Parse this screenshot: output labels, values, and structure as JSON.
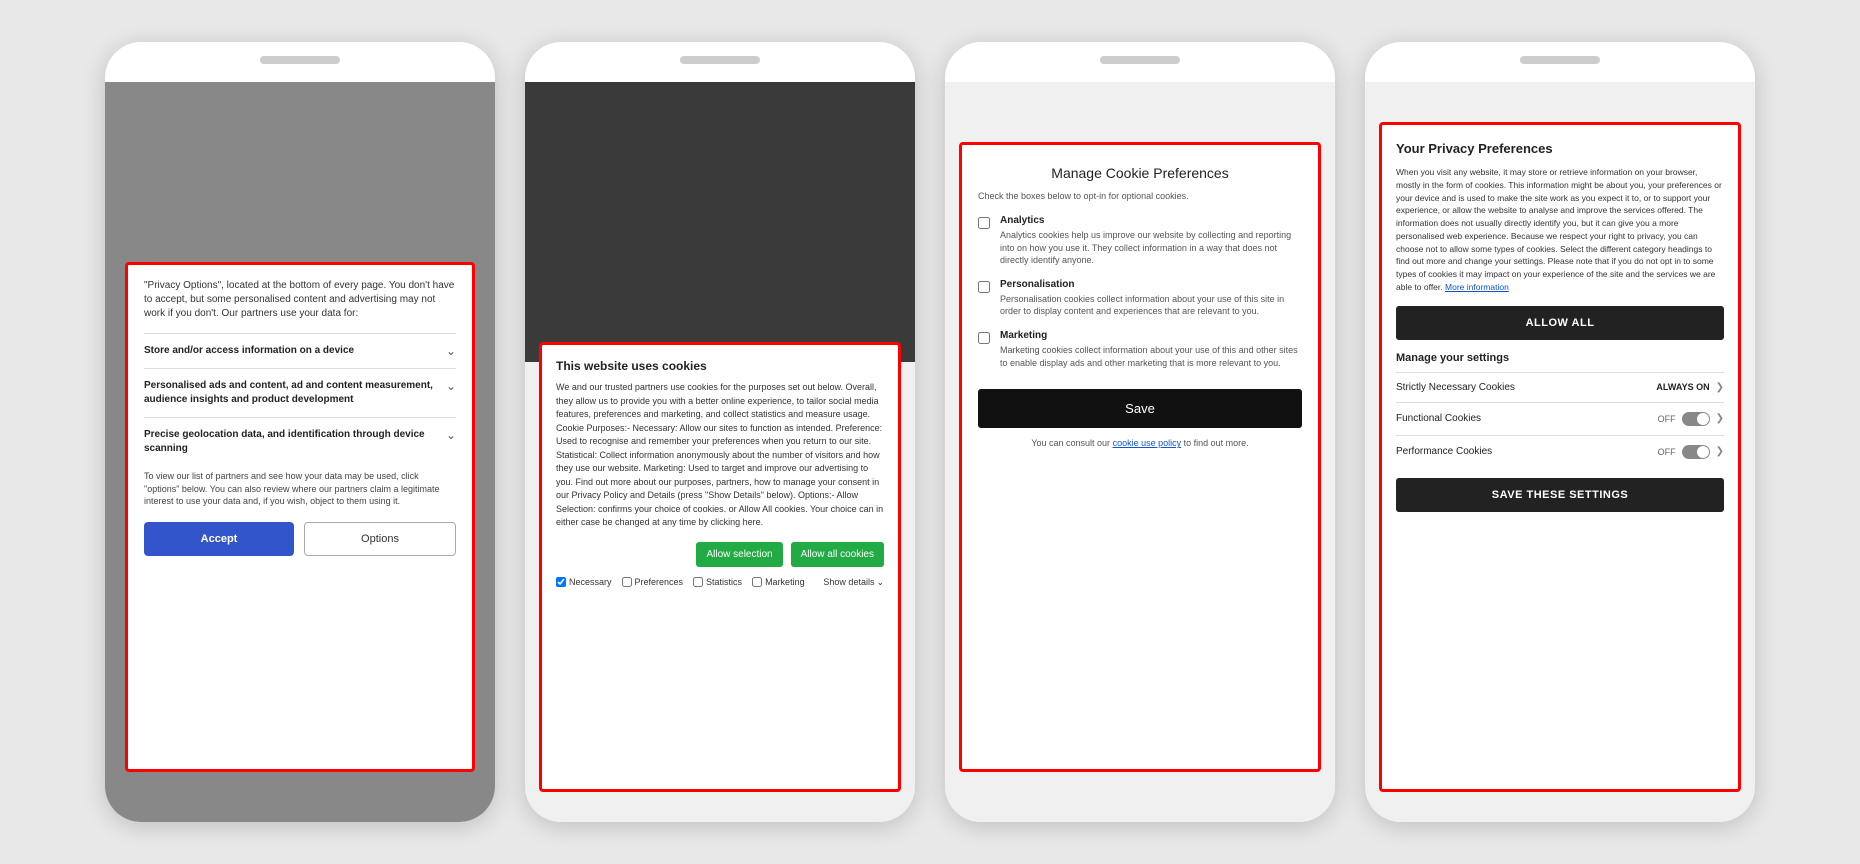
{
  "phone1": {
    "intro_text": "\"Privacy Options\", located at the bottom of every page. You don't have to accept, but some personalised content and advertising may not work if you don't. Our partners use your data for:",
    "options": [
      {
        "label": "Store and/or access information on a device",
        "has_chevron": true
      },
      {
        "label": "Personalised ads and content, ad and content measurement, audience insights and product development",
        "has_chevron": true
      },
      {
        "label": "Precise geolocation data, and identification through device scanning",
        "has_chevron": true
      }
    ],
    "footer_text": "To view our list of partners and see how your data may be used, click \"options\" below. You can also review where our partners claim a legitimate interest to use your data and, if you wish, object to them using it.",
    "accept_label": "Accept",
    "options_label": "Options"
  },
  "phone2": {
    "title": "This website uses cookies",
    "body": "We and our trusted partners use cookies for the purposes set out below. Overall, they allow us to provide you with a better online experience, to tailor social media features, preferences and marketing, and collect statistics and measure usage. Cookie Purposes:- Necessary: Allow our sites to function as intended. Preference: Used to recognise and remember your preferences when you return to our site. Statistical: Collect information anonymously about the number of visitors and how they use our website. Marketing: Used to target and improve our advertising to you. Find out more about our purposes, partners, how to manage your consent in our Privacy Policy and Details (press \"Show Details\" below). Options:- Allow Selection: confirms your choice of cookies. or Allow All cookies. Your choice can in either case be changed at any time by clicking here.",
    "allow_selection_label": "Allow selection",
    "allow_all_label": "Allow all cookies",
    "checkboxes": [
      {
        "label": "Necessary",
        "checked": true
      },
      {
        "label": "Preferences",
        "checked": false
      },
      {
        "label": "Statistics",
        "checked": false
      },
      {
        "label": "Marketing",
        "checked": false
      }
    ],
    "show_details_label": "Show details"
  },
  "phone3": {
    "title": "Manage Cookie Preferences",
    "subtitle": "Check the boxes below to opt-in for optional cookies.",
    "cookie_options": [
      {
        "label": "Analytics",
        "desc": "Analytics cookies help us improve our website by collecting and reporting into on how you use it. They collect information in a way that does not directly identify anyone.",
        "checked": false
      },
      {
        "label": "Personalisation",
        "desc": "Personalisation cookies collect information about your use of this site in order to display content and experiences that are relevant to you.",
        "checked": false
      },
      {
        "label": "Marketing",
        "desc": "Marketing cookies collect information about your use of this and other sites to enable display ads and other marketing that is more relevant to you.",
        "checked": false
      }
    ],
    "save_label": "Save",
    "footer_text": "You can consult our",
    "footer_link": "cookie use policy",
    "footer_suffix": "to find out more."
  },
  "phone4": {
    "title": "Your Privacy Preferences",
    "body": "When you visit any website, it may store or retrieve information on your browser, mostly in the form of cookies. This information might be about you, your preferences or your device and is used to make the site work as you expect it to, or to support your experience, or allow the website to analyse and improve the services offered. The information does not usually directly identify you, but it can give you a more personalised web experience. Because we respect your right to privacy, you can choose not to allow some types of cookies. Select the different category headings to find out more and change your settings. Please note that if you do not opt in to some types of cookies it may impact on your experience of the site and the services we are able to offer.",
    "more_info_link": "More information",
    "allow_all_label": "ALLOW ALL",
    "manage_settings_label": "Manage your settings",
    "settings_rows": [
      {
        "label": "Strictly Necessary Cookies",
        "status": "ALWAYS ON",
        "type": "always_on"
      },
      {
        "label": "Functional Cookies",
        "status": "OFF",
        "type": "toggle"
      },
      {
        "label": "Performance Cookies",
        "status": "OFF",
        "type": "toggle"
      }
    ],
    "save_settings_label": "SAVE THESE SETTINGS"
  }
}
